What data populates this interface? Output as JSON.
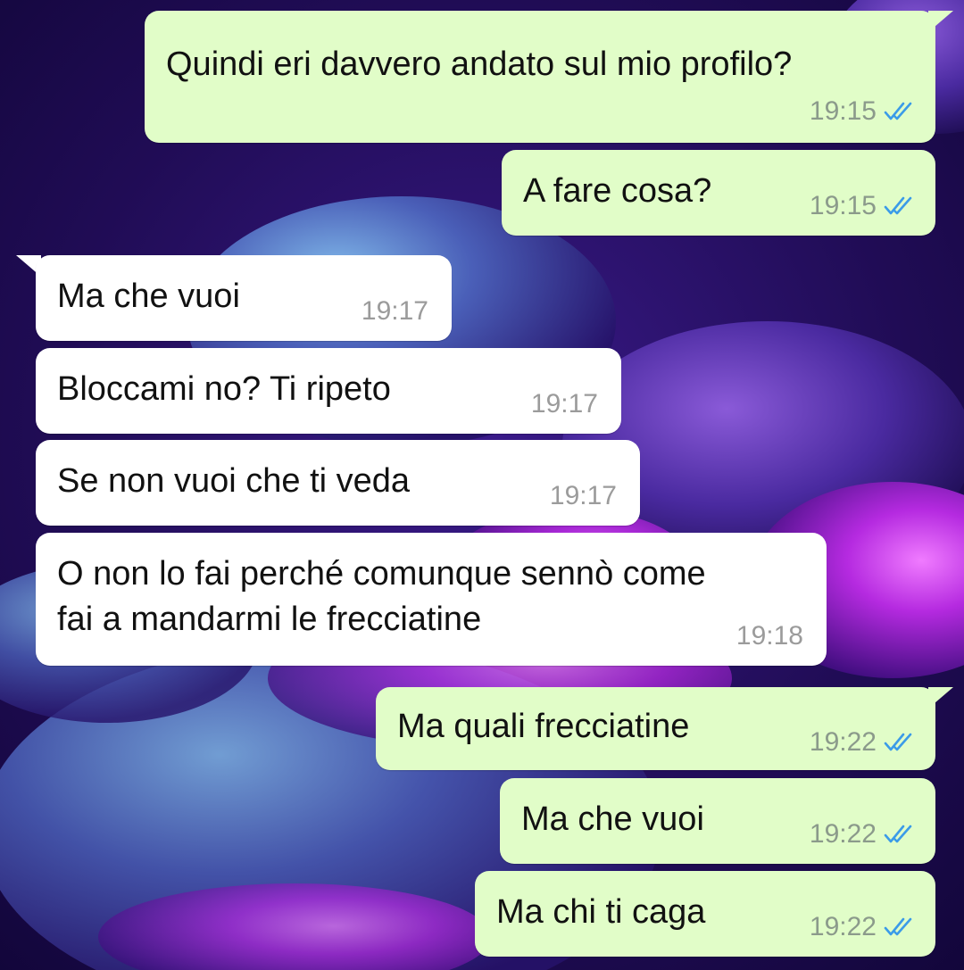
{
  "colors": {
    "outgoing_bubble": "#e1fdc8",
    "incoming_bubble": "#ffffff",
    "read_ticks": "#3b9be8",
    "wallpaper_base": "#1a0a3a"
  },
  "messages": [
    {
      "direction": "out",
      "text": "Quindi eri davvero andato sul mio profilo?",
      "time": "19:15",
      "status": "read",
      "icon": "double-check-icon"
    },
    {
      "direction": "out",
      "text": "A fare cosa?",
      "time": "19:15",
      "status": "read",
      "icon": "double-check-icon"
    },
    {
      "direction": "in",
      "text": "Ma che vuoi",
      "time": "19:17"
    },
    {
      "direction": "in",
      "text": "Bloccami no? Ti ripeto",
      "time": "19:17"
    },
    {
      "direction": "in",
      "text": "Se non vuoi che ti veda",
      "time": "19:17"
    },
    {
      "direction": "in",
      "text_line1": "O non lo fai perché comunque sennò come",
      "text_line2": "fai a mandarmi le frecciatine",
      "time": "19:18"
    },
    {
      "direction": "out",
      "text": "Ma quali frecciatine",
      "time": "19:22",
      "status": "read",
      "icon": "double-check-icon"
    },
    {
      "direction": "out",
      "text": "Ma che vuoi",
      "time": "19:22",
      "status": "read",
      "icon": "double-check-icon"
    },
    {
      "direction": "out",
      "text": "Ma chi ti caga",
      "time": "19:22",
      "status": "read",
      "icon": "double-check-icon"
    }
  ]
}
